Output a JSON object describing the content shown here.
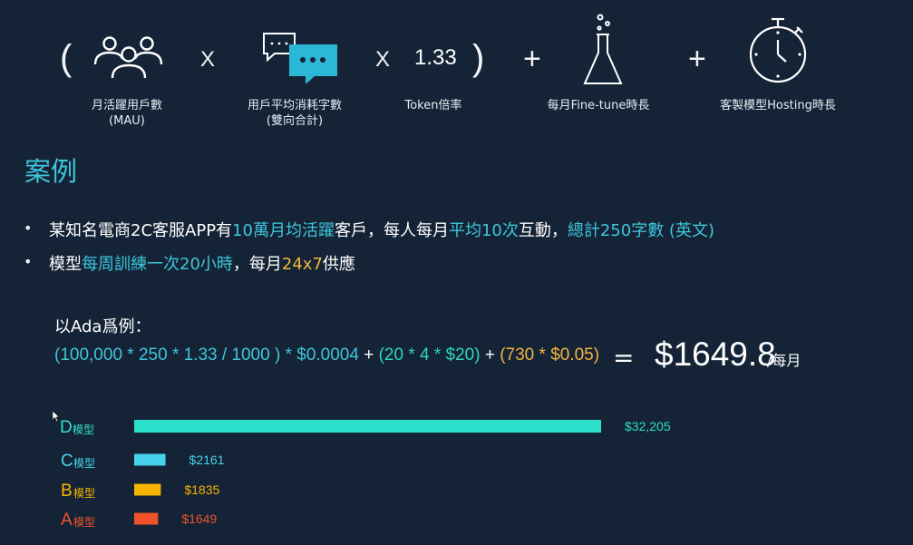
{
  "formula_row": {
    "paren_open": "(",
    "times_1": "X",
    "times_2": "X",
    "token_ratio": "1.33",
    "paren_close": ")",
    "plus_1": "+",
    "plus_2": "+",
    "items": [
      {
        "caption": [
          "月活躍用戶數",
          "(MAU)"
        ],
        "icon": "users-icon"
      },
      {
        "caption": [
          "用戶平均消耗字數",
          "(雙向合計)"
        ],
        "icon": "chat-bubbles-icon"
      },
      {
        "caption": [
          "Token倍率"
        ],
        "icon": ""
      },
      {
        "caption": [
          "每月Fine-tune時長"
        ],
        "icon": "flask-icon"
      },
      {
        "caption": [
          "客製模型Hosting時長"
        ],
        "icon": "stopwatch-icon"
      }
    ]
  },
  "section_title": "案例",
  "bullets": [
    {
      "parts": [
        {
          "text": "某知名電商2C客服APP有",
          "color": "white"
        },
        {
          "text": "10萬月均活躍",
          "color": "teal"
        },
        {
          "text": "客戶，每人每月",
          "color": "white"
        },
        {
          "text": "平均10次",
          "color": "teal"
        },
        {
          "text": "互動，",
          "color": "white"
        },
        {
          "text": "總計250字數 (英文)",
          "color": "teal"
        }
      ]
    },
    {
      "parts": [
        {
          "text": "模型",
          "color": "white"
        },
        {
          "text": "每周訓練一次20小時",
          "color": "teal"
        },
        {
          "text": "，每月",
          "color": "white"
        },
        {
          "text": "24x7",
          "color": "orange"
        },
        {
          "text": "供應",
          "color": "white"
        }
      ]
    }
  ],
  "example": {
    "title": "以Ada爲例：",
    "formula_parts": [
      {
        "text": "(100,000 * 250 * 1.33 / 1000 ) * $0.0004",
        "color": "teal"
      },
      {
        "text": " + ",
        "color": "white"
      },
      {
        "text": "(20 * 4 * $20)",
        "color": "green"
      },
      {
        "text": " + ",
        "color": "white"
      },
      {
        "text": "(730 * $0.05)",
        "color": "orange"
      }
    ],
    "equals": "=",
    "result": "$1649.8",
    "unit": "/每月"
  },
  "colors": {
    "white": "#ffffff",
    "teal": "#3ec6dc",
    "green": "#2cd8c0",
    "orange": "#f3b63c",
    "bar_d": "#2de0cc",
    "bar_c": "#45d3ec",
    "bar_b": "#f7b500",
    "bar_a": "#f0532a"
  },
  "chart_data": {
    "type": "bar",
    "orientation": "horizontal",
    "categories": [
      {
        "letter": "D",
        "suffix": "模型"
      },
      {
        "letter": "C",
        "suffix": "模型"
      },
      {
        "letter": "B",
        "suffix": "模型"
      },
      {
        "letter": "A",
        "suffix": "模型"
      }
    ],
    "values": [
      32205,
      2161,
      1835,
      1649
    ],
    "value_labels": [
      "$32,205",
      "$2161",
      "$1835",
      "$1649"
    ],
    "colors": [
      "#2de0cc",
      "#45d3ec",
      "#f7b500",
      "#f0532a"
    ],
    "label_colors": [
      "#2de0cc",
      "#45d3ec",
      "#f7b500",
      "#f0532a"
    ]
  }
}
